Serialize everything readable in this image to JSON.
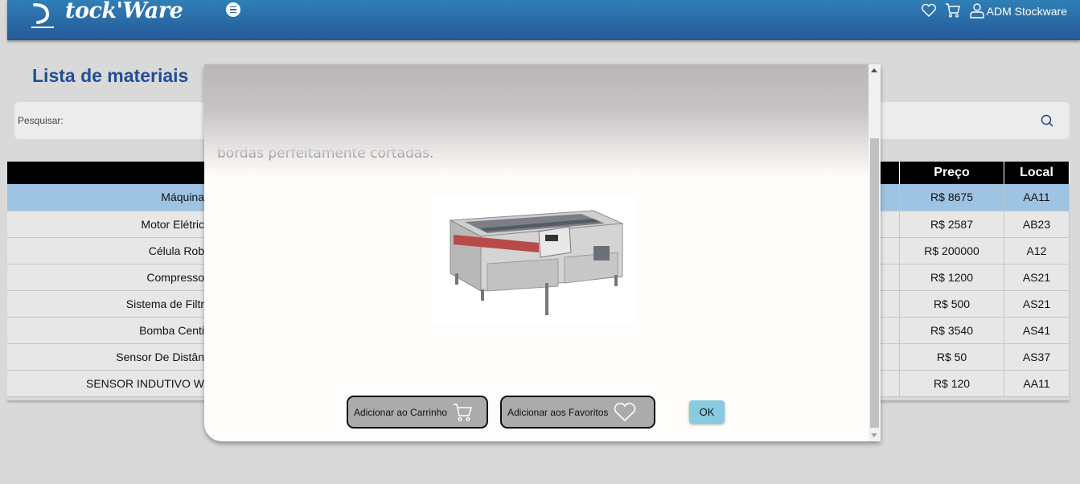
{
  "header": {
    "logo_text": "tock'Ware",
    "user_name": "ADM Stockware"
  },
  "page": {
    "title": "Lista de materiais",
    "search_label": "Pesquisar:"
  },
  "table": {
    "headers": {
      "preco": "Preço",
      "local": "Local"
    },
    "rows": [
      {
        "name": "Máquina",
        "price": "R$ 8675",
        "local": "AA11",
        "selected": true
      },
      {
        "name": "Motor Elétric",
        "price": "R$ 2587",
        "local": "AB23"
      },
      {
        "name": "Célula Rob",
        "price": "R$ 200000",
        "local": "A12"
      },
      {
        "name": "Compresso",
        "price": "R$ 1200",
        "local": "AS21"
      },
      {
        "name": "Sistema de Filtr",
        "price": "R$ 500",
        "local": "AS21"
      },
      {
        "name": "Bomba Centi",
        "price": "R$ 3540",
        "local": "AS41"
      },
      {
        "name": "Sensor De Distân",
        "price": "R$ 50",
        "local": "AS37"
      },
      {
        "name": "SENSOR INDUTIVO W",
        "price": "R$ 120",
        "local": "AA11"
      }
    ]
  },
  "modal": {
    "description": "preciso e rápido de materiais metálicos e não metálicos. Equipada com um potente laser de alta intensidade, esta máquina é capaz de cortar uma variedade de materiais, como aço inoxidável, alumínio, acrílico e madeira. Com um sistema de controle computadorizado, a máquina oferece precisão milimétrica, permitindo a criação de formas complexas com bordas perfeitamente cortadas.",
    "add_cart_label": "Adicionar ao Carrinho",
    "add_fav_label": "Adicionar aos Favoritos",
    "ok_label": "OK"
  },
  "icons": {
    "logo": "stockware-logo-icon",
    "menu": "menu-icon",
    "favorites": "heart-icon",
    "cart": "cart-icon",
    "user": "user-icon",
    "search": "search-icon"
  },
  "colors": {
    "header_top": "#2f7fb7",
    "header_bottom": "#25589a",
    "title": "#1f4e96",
    "selected_row": "#9ec3e3",
    "ok_button": "#88cbe0"
  }
}
